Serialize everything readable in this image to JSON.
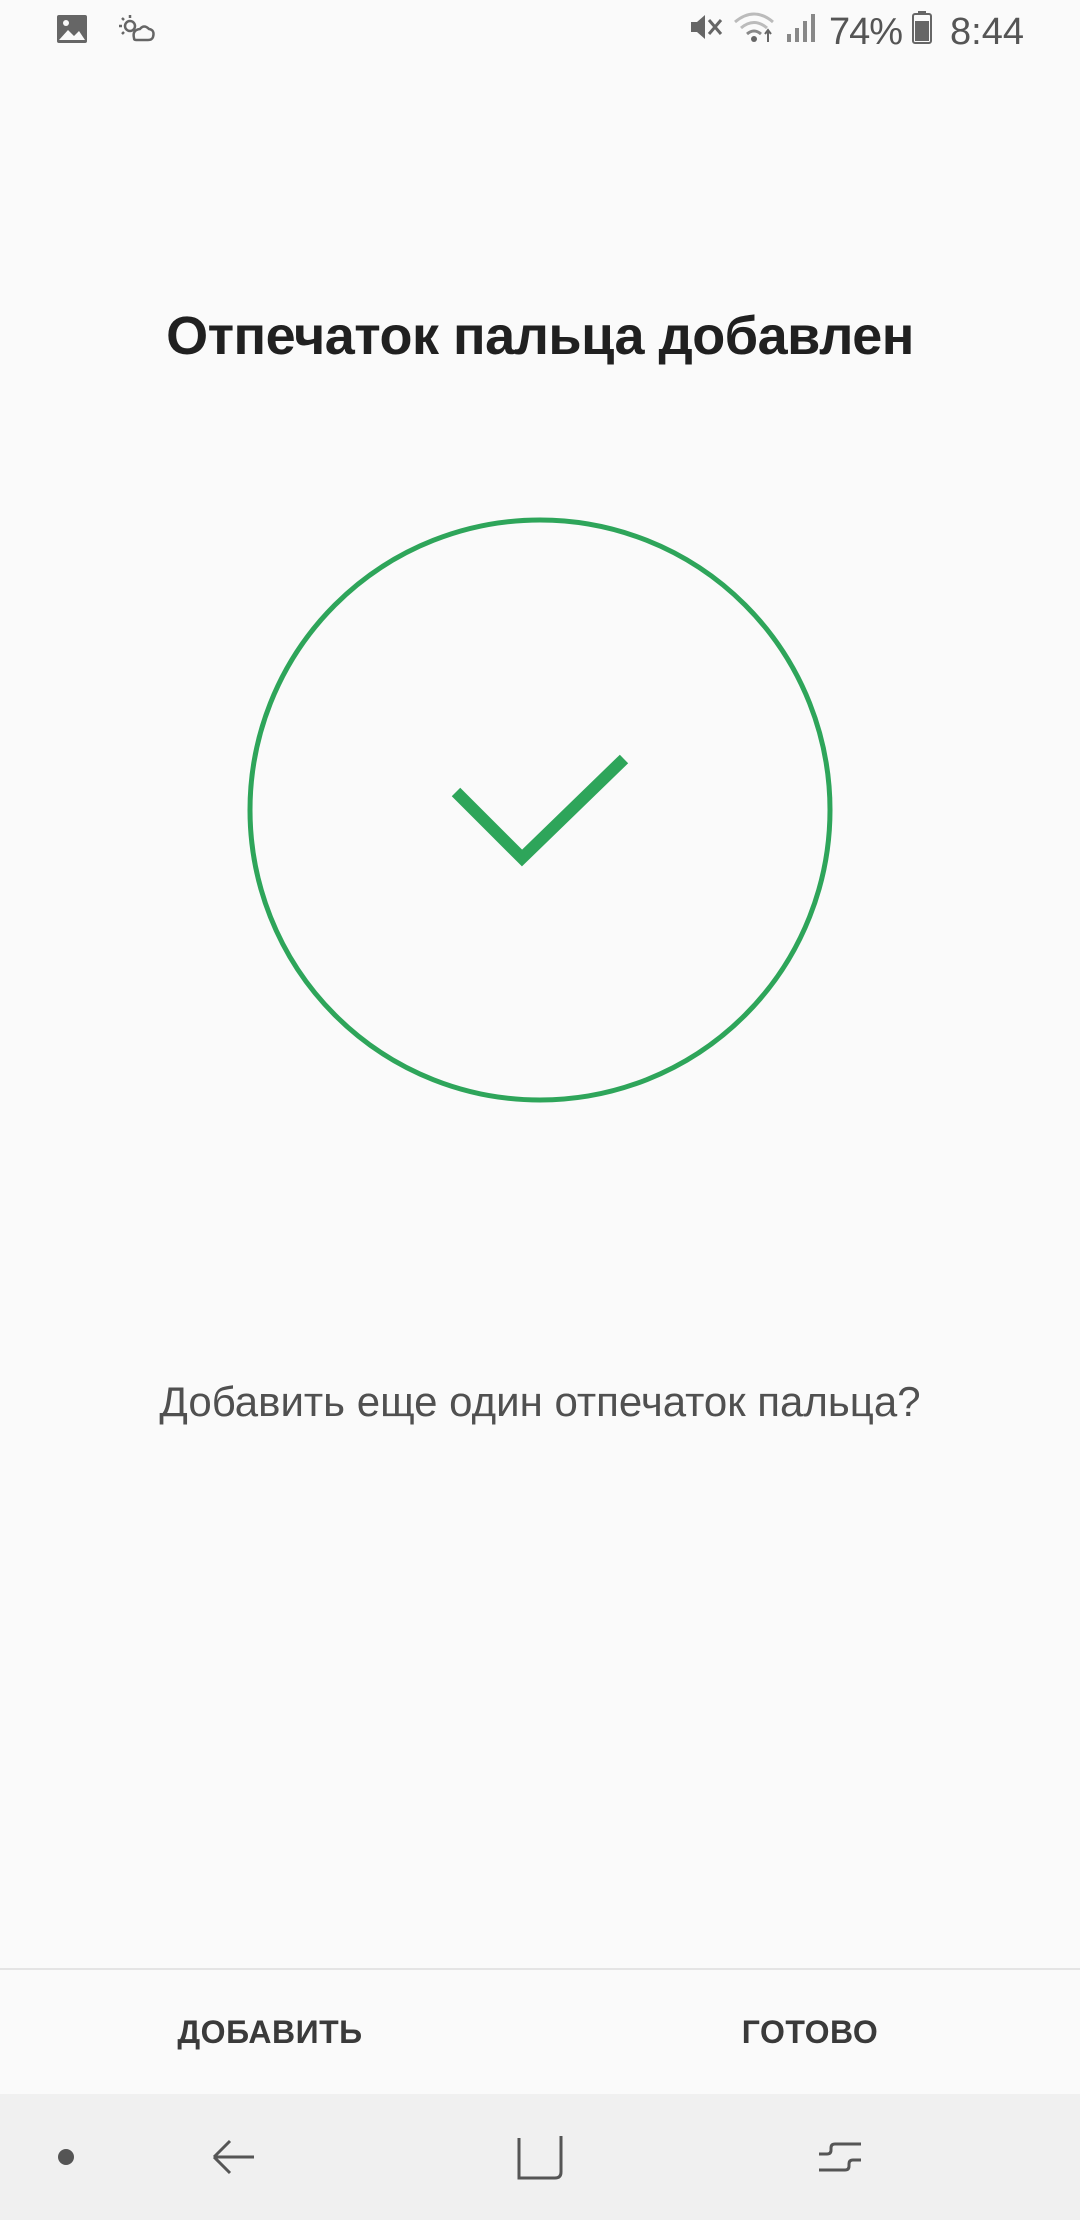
{
  "status_bar": {
    "left_icons": [
      "gallery-icon",
      "weather-icon"
    ],
    "right_icons": [
      "mute-icon",
      "wifi-icon",
      "signal-icon",
      "battery-icon"
    ],
    "battery_percent": "74%",
    "time": "8:44"
  },
  "screen": {
    "title": "Отпечаток пальца добавлен",
    "success_icon": "check-circle-icon",
    "question": "Добавить еще один отпечаток пальца?"
  },
  "actions": {
    "add_label": "ДОБАВИТЬ",
    "done_label": "ГОТОВО"
  },
  "nav_bar": {
    "items": [
      "dot-icon",
      "back-icon",
      "home-icon",
      "recents-icon"
    ]
  },
  "colors": {
    "accent_green": "#2ea55a",
    "background": "#fafafa",
    "nav_background": "#f0f0f0"
  }
}
